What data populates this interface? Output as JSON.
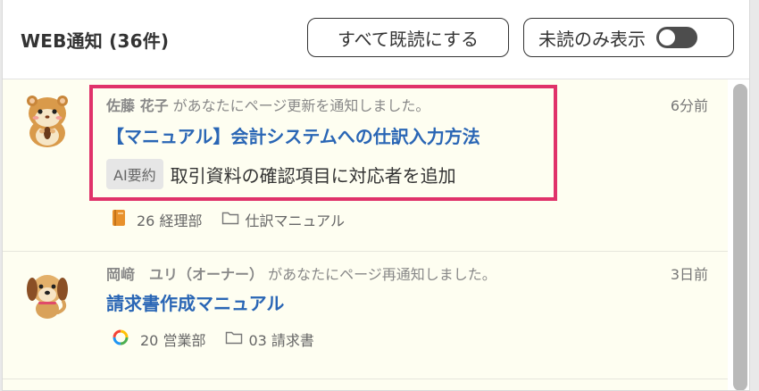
{
  "header": {
    "title": "WEB通知 (36件)",
    "mark_all_read_label": "すべて既読にする",
    "unread_only_label": "未読のみ表示"
  },
  "notifications": [
    {
      "actor": "佐藤 花子",
      "message": "があなたにページ更新を通知しました。",
      "time": "6分前",
      "page_title": "【マニュアル】会計システムへの仕訳入力方法",
      "ai_badge": "AI要約",
      "summary": "取引資料の確認項目に対応者を追加",
      "space": "26 経理部",
      "folder": "仕訳マニュアル",
      "space_icon": "book-icon",
      "avatar": "hamster-avatar"
    },
    {
      "actor": "岡﨑　ユリ（オーナー）",
      "message": "があなたにページ再通知しました。",
      "time": "3日前",
      "page_title": "請求書作成マニュアル",
      "space": "20 営業部",
      "folder": "03 請求書",
      "space_icon": "ring-icon",
      "avatar": "dog-avatar"
    }
  ],
  "colors": {
    "accent_link": "#2a66b5",
    "highlight": "#e0326a",
    "unread_bg": "#fefef1"
  }
}
